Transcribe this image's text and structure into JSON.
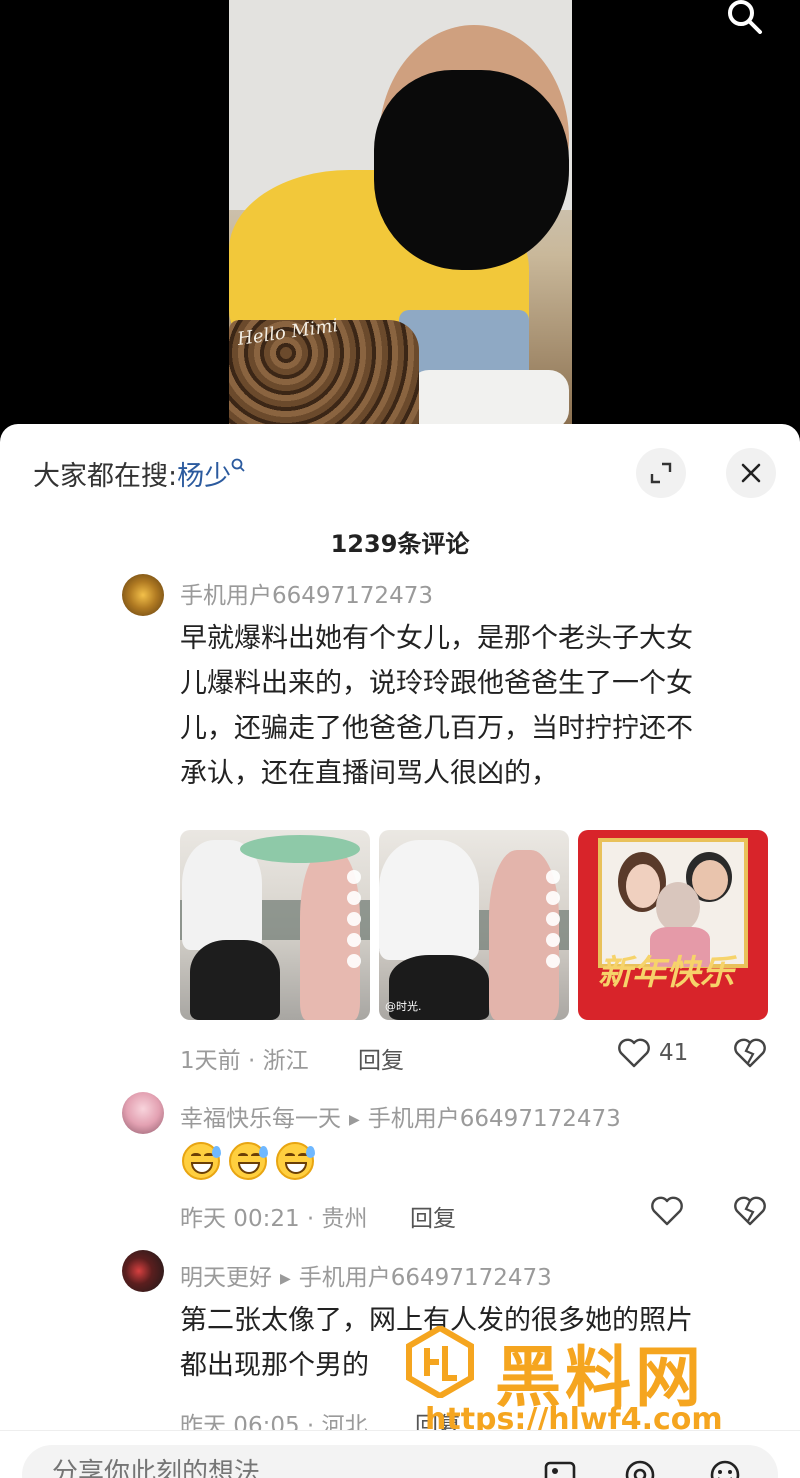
{
  "hot_search": {
    "prefix": "大家都在搜:",
    "term": "杨少"
  },
  "comment_count": "1239条评论",
  "comments": [
    {
      "user": "手机用户66497172473",
      "text_lines": [
        "早就爆料出她有个女儿，是那个老头子大女",
        "儿爆料出来的，说玲玲跟他爸爸生了一个女",
        "儿，还骗走了他爸爸几百万，当时拧拧还不",
        "承认，还在直播间骂人很凶的，"
      ],
      "meta": "1天前 · 浙江",
      "reply": "回复",
      "likes": "41"
    },
    {
      "user": "幸福快乐每一天",
      "reply_to": "手机用户66497172473",
      "meta": "昨天 00:21 · 贵州",
      "reply": "回复"
    },
    {
      "user": "明天更好",
      "reply_to": "手机用户66497172473",
      "text_lines": [
        "第二张太像了，网上有人发的很多她的照片",
        "都出现那个男的"
      ],
      "meta": "昨天 06:05 · 河北",
      "reply": "回复"
    }
  ],
  "thumbnails": {
    "thumb2_caption": "@时光.",
    "thumb3_caption": "新年快乐"
  },
  "video": {
    "bag_text": "Hello Mimi"
  },
  "watermark": {
    "title": "黑料网",
    "url": "https://hlwf4.com"
  },
  "input": {
    "placeholder": "分享你此刻的想法"
  },
  "colors": {
    "accent_link": "#2b5a9e",
    "watermark": "#f5a51f"
  }
}
